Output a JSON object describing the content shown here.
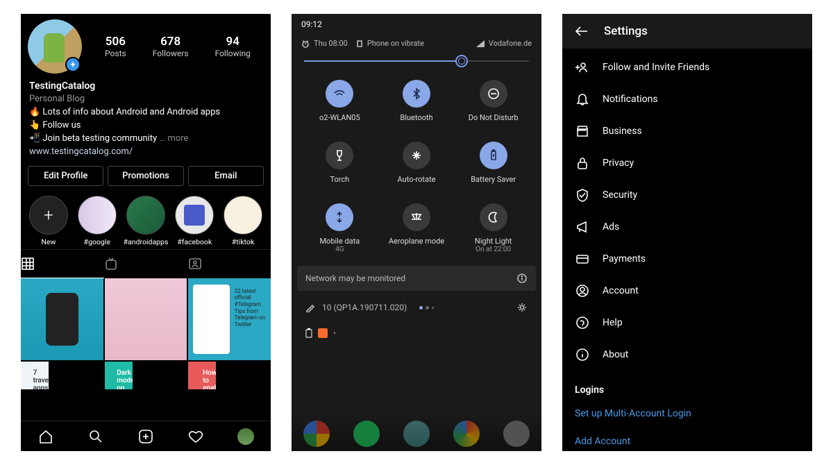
{
  "phone1": {
    "username": "TestingCatalog",
    "category": "Personal Blog",
    "bio_lines": [
      "🔥 Lots of info about Android and Android apps",
      "👆 Follow us",
      "📲 Join beta testing community"
    ],
    "more_label": "… more",
    "website": "www.testingcatalog.com/",
    "stats": {
      "posts_num": "506",
      "posts_lbl": "Posts",
      "followers_num": "678",
      "followers_lbl": "Followers",
      "following_num": "94",
      "following_lbl": "Following"
    },
    "buttons": {
      "edit": "Edit Profile",
      "promo": "Promotions",
      "email": "Email"
    },
    "highlights": [
      {
        "label": "New"
      },
      {
        "label": "#google"
      },
      {
        "label": "#androidapps"
      },
      {
        "label": "#facebook"
      },
      {
        "label": "#tiktok"
      }
    ]
  },
  "phone2": {
    "time": "09:12",
    "alarm": "Thu 08:00",
    "vibe": "Phone on vibrate",
    "carrier": "Vodafone.de",
    "tiles": [
      {
        "label": "o2-WLAN05",
        "sub": "",
        "on": true
      },
      {
        "label": "Bluetooth",
        "sub": "",
        "on": true
      },
      {
        "label": "Do Not Disturb",
        "sub": "",
        "on": false
      },
      {
        "label": "Torch",
        "sub": "",
        "on": false
      },
      {
        "label": "Auto-rotate",
        "sub": "",
        "on": false
      },
      {
        "label": "Battery Saver",
        "sub": "",
        "on": true
      },
      {
        "label": "Mobile data",
        "sub": "4G",
        "on": true
      },
      {
        "label": "Aeroplane mode",
        "sub": "",
        "on": false
      },
      {
        "label": "Night Light",
        "sub": "On at 22:00",
        "on": false
      }
    ],
    "network_msg": "Network may be monitored",
    "update_msg": "10 (QP1A.190711.020)"
  },
  "phone3": {
    "title": "Settings",
    "items": [
      {
        "icon": "add-person",
        "label": "Follow and Invite Friends"
      },
      {
        "icon": "bell",
        "label": "Notifications"
      },
      {
        "icon": "shop",
        "label": "Business"
      },
      {
        "icon": "lock",
        "label": "Privacy"
      },
      {
        "icon": "shield",
        "label": "Security"
      },
      {
        "icon": "megaphone",
        "label": "Ads"
      },
      {
        "icon": "card",
        "label": "Payments"
      },
      {
        "icon": "account",
        "label": "Account"
      },
      {
        "icon": "help",
        "label": "Help"
      },
      {
        "icon": "info",
        "label": "About"
      }
    ],
    "section": "Logins",
    "links": [
      "Set up Multi-Account Login",
      "Add Account"
    ]
  }
}
